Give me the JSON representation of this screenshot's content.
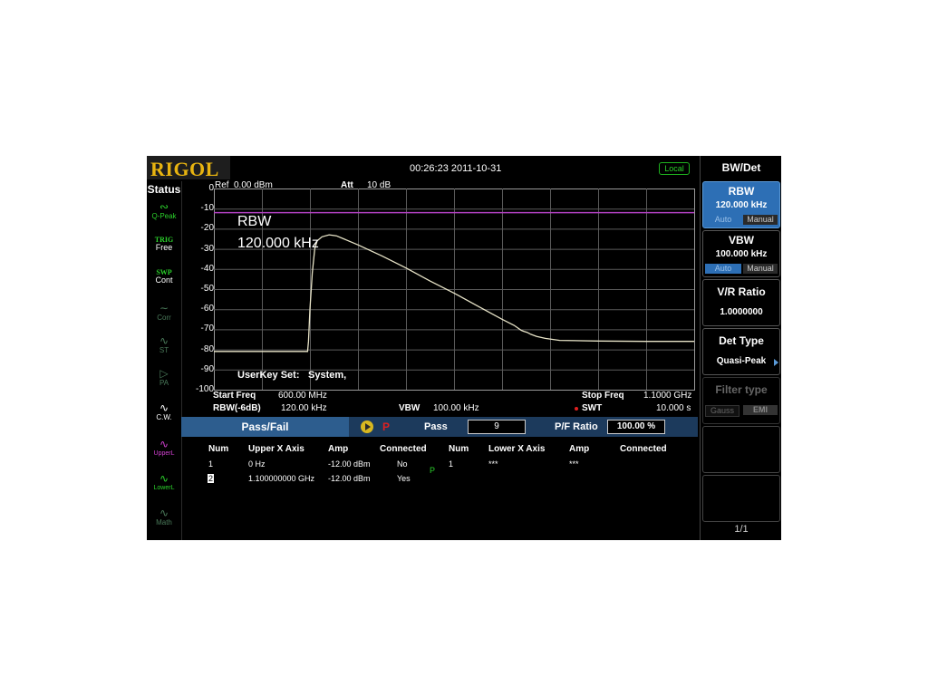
{
  "header": {
    "logo": "RIGOL",
    "datetime": "00:26:23 2011-10-31",
    "mode_badge": "Local"
  },
  "status": {
    "title": "Status",
    "items": [
      {
        "label": "Q-Peak",
        "icon": "detector-icon",
        "color": "#2bd02b"
      },
      {
        "label": "Free",
        "prefix": "TRIG",
        "icon": "trigger-icon",
        "color": "#2bd02b"
      },
      {
        "label": "Cont",
        "prefix": "SWP",
        "icon": "sweep-icon",
        "color": "#2bd02b"
      },
      {
        "label": "Corr",
        "icon": "correction-icon",
        "color": "#4a7a5a"
      },
      {
        "label": "ST",
        "icon": "track-icon",
        "color": "#4a7a5a"
      },
      {
        "label": "PA",
        "icon": "preamp-icon",
        "color": "#4a7a5a"
      },
      {
        "label": "C.W.",
        "icon": "cw-icon",
        "color": "#ffffff"
      },
      {
        "label": "UpperL",
        "icon": "upper-limit-icon",
        "color": "#d040d0"
      },
      {
        "label": "LowerL",
        "icon": "lower-limit-icon",
        "color": "#2bd02b"
      },
      {
        "label": "Math",
        "icon": "math-icon",
        "color": "#4a7a5a"
      }
    ]
  },
  "plot": {
    "ref_label": "Ref",
    "ref_value": "0.00 dBm",
    "att_label": "Att",
    "att_value": "10 dB",
    "y_ticks": [
      "0",
      "-10",
      "-20",
      "-30",
      "-40",
      "-50",
      "-60",
      "-70",
      "-80",
      "-90",
      "-100"
    ],
    "overlay_rbw_label": "RBW",
    "overlay_rbw_value": "120.000 kHz",
    "userkey_label": "UserKey Set:",
    "userkey_value": "System,",
    "start_freq_label": "Start Freq",
    "start_freq_value": "600.00 MHz",
    "stop_freq_label": "Stop Freq",
    "stop_freq_value": "1.1000 GHz",
    "rbw6db_label": "RBW(-6dB)",
    "rbw6db_value": "120.00 kHz",
    "vbw_label": "VBW",
    "vbw_value": "100.00 kHz",
    "swt_label": "SWT",
    "swt_value": "10.000 s",
    "limit_line_db": -12,
    "trace_color": "#e8e4c8",
    "limit_color": "#b040c0"
  },
  "passfail": {
    "tab_label": "Pass/Fail",
    "p_flag": "P",
    "pass_label": "Pass",
    "pass_count": "9",
    "ratio_label": "P/F Ratio",
    "ratio_value": "100.00 %"
  },
  "upper_table": {
    "headers": [
      "Num",
      "Upper X Axis",
      "Amp",
      "Connected"
    ],
    "rows": [
      [
        "1",
        "0 Hz",
        "-12.00 dBm",
        "No"
      ],
      [
        "2",
        "1.100000000 GHz",
        "-12.00 dBm",
        "Yes"
      ]
    ]
  },
  "p_marker": "P",
  "lower_table": {
    "headers": [
      "Num",
      "Lower X Axis",
      "Amp",
      "Connected"
    ],
    "rows": [
      [
        "1",
        "***",
        "***",
        ""
      ]
    ]
  },
  "menu": {
    "title": "BW/Det",
    "rbw": {
      "title": "RBW",
      "value": "120.000 kHz",
      "opt1": "Auto",
      "opt2": "Manual"
    },
    "vbw": {
      "title": "VBW",
      "value": "100.000 kHz",
      "opt1": "Auto",
      "opt2": "Manual"
    },
    "vr_ratio": {
      "title": "V/R Ratio",
      "value": "1.0000000"
    },
    "det_type": {
      "title": "Det Type",
      "value": "Quasi-Peak"
    },
    "filter_type": {
      "title": "Filter type",
      "opt1": "Gauss",
      "opt2": "EMI"
    },
    "page": "1/1"
  }
}
